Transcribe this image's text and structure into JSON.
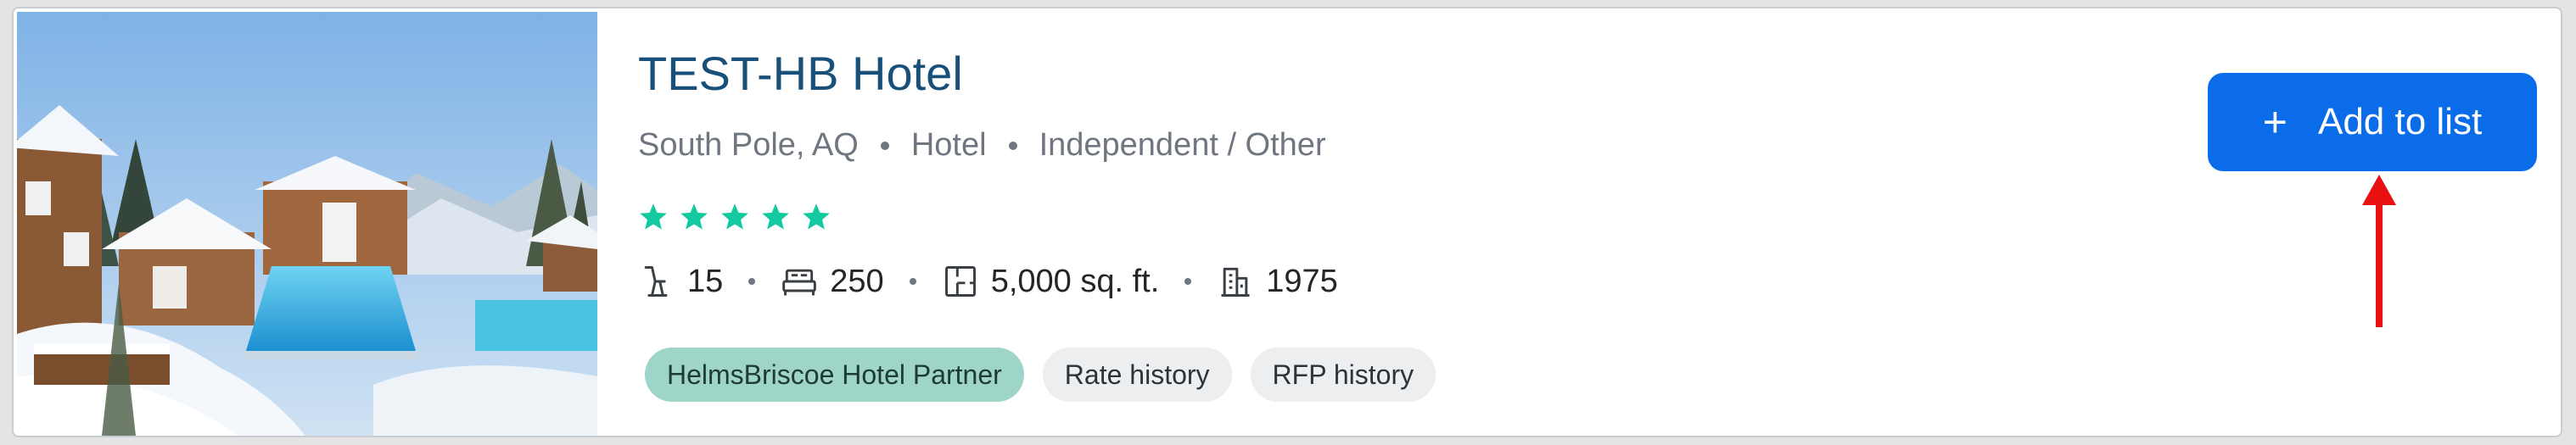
{
  "hotel": {
    "name": "TEST-HB Hotel",
    "location": "South Pole, AQ",
    "type": "Hotel",
    "brand": "Independent / Other",
    "star_rating": 5,
    "star_color": "#13c9a0"
  },
  "stats": {
    "meeting_rooms": "15",
    "guest_rooms": "250",
    "meeting_space": "5,000 sq. ft.",
    "year_built": "1975"
  },
  "tags": {
    "partner": "HelmsBriscoe Hotel Partner",
    "rate_history": "Rate history",
    "rfp_history": "RFP history"
  },
  "actions": {
    "add_icon": "+",
    "add_label": "Add to list",
    "button_color": "#0a6ce8"
  },
  "annotation": {
    "arrow_color": "#e81010"
  }
}
